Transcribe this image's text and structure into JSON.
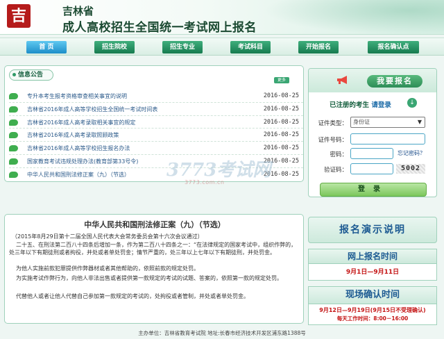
{
  "header": {
    "logo_char": "吉",
    "title_line1": "吉林省",
    "title_line2": "成人高校招生全国统一考试网上报名"
  },
  "nav": {
    "items": [
      {
        "label": "首 页",
        "active": true
      },
      {
        "label": "招生院校",
        "active": false
      },
      {
        "label": "招生专业",
        "active": false
      },
      {
        "label": "考试科目",
        "active": false
      },
      {
        "label": "开始报名",
        "active": false
      },
      {
        "label": "报名确认点",
        "active": false
      }
    ]
  },
  "notice": {
    "title": "信息公告",
    "more_label": "更多",
    "items": [
      {
        "text": "专升本考生报考资格审查相关事宜的说明",
        "date": "2016-08-25"
      },
      {
        "text": "吉林省2016年成人高等学校招生全国统一考试时间表",
        "date": "2016-08-25"
      },
      {
        "text": "吉林省2016年成人高考录取相关事宜的规定",
        "date": "2016-08-25"
      },
      {
        "text": "吉林省2016年成人高考录取照顾政策",
        "date": "2016-08-25"
      },
      {
        "text": "吉林省2016年成人高等学校招生报名办法",
        "date": "2016-08-25"
      },
      {
        "text": "国家教育考试违规处理办法(教育部第33号令)",
        "date": "2016-08-25"
      },
      {
        "text": "中华人民共和国刑法修正案（九）（节选）",
        "date": "2016-08-25"
      }
    ]
  },
  "register": {
    "title": "我要报名",
    "hint_prefix": "已注册的考生",
    "hint_action": "请登录",
    "id_type_label": "证件类型：",
    "id_type_value": "身份证",
    "id_number_label": "证件号码：",
    "password_label": "密码：",
    "forgot_label": "忘记密码？",
    "captcha_label": "验证码：",
    "captcha_value": "5002",
    "login_label": "登录"
  },
  "watermark": {
    "main": "3773考试网",
    "sub": "3773.com.cn"
  },
  "law": {
    "title": "中华人民共和国刑法修正案（九）（节选）",
    "paragraphs": [
      "（2015年8月29日第十二届全国人民代表大会常务委员会第十六次会议通过）",
      "二十五、在刑法第二百八十四条后增加一条，作为第二百八十四条之一：“在法律规定的国家考试中，组织作弊的，处三年以下有期徒刑或者拘役，并处或者单处罚金；情节严重的，处三年以上七年以下有期徒刑，并处罚金。",
      "为他人实施前款犯罪提供作弊器材或者其他帮助的，依照前款的规定处罚。",
      "为实施考试作弊行为，向他人非法出售或者提供第一款规定的考试的试题、答案的，依照第一款的规定处罚。",
      "代替他人或者让他人代替自己参加第一款规定的考试的，处拘役或者管制，并处或者单处罚金。"
    ]
  },
  "right_info": {
    "demo_title": "报名演示说明",
    "online_title": "网上报名时间",
    "online_dates": "9月1日—9月11日",
    "onsite_title": "现场确认时间",
    "onsite_dates": "9月12日—9月19日(9月15日不受理确认)",
    "onsite_hours": "每天工作时间：8:00－16:00"
  },
  "footer": {
    "text": "主办单位：吉林省教育考试院    地址:长春市经济技术开发区浦东路1388号"
  },
  "colors": {
    "nav_green": "#167b4f",
    "nav_active": "#1d8ec9",
    "accent_red": "#c41414",
    "link_blue": "#2b5a8a"
  }
}
